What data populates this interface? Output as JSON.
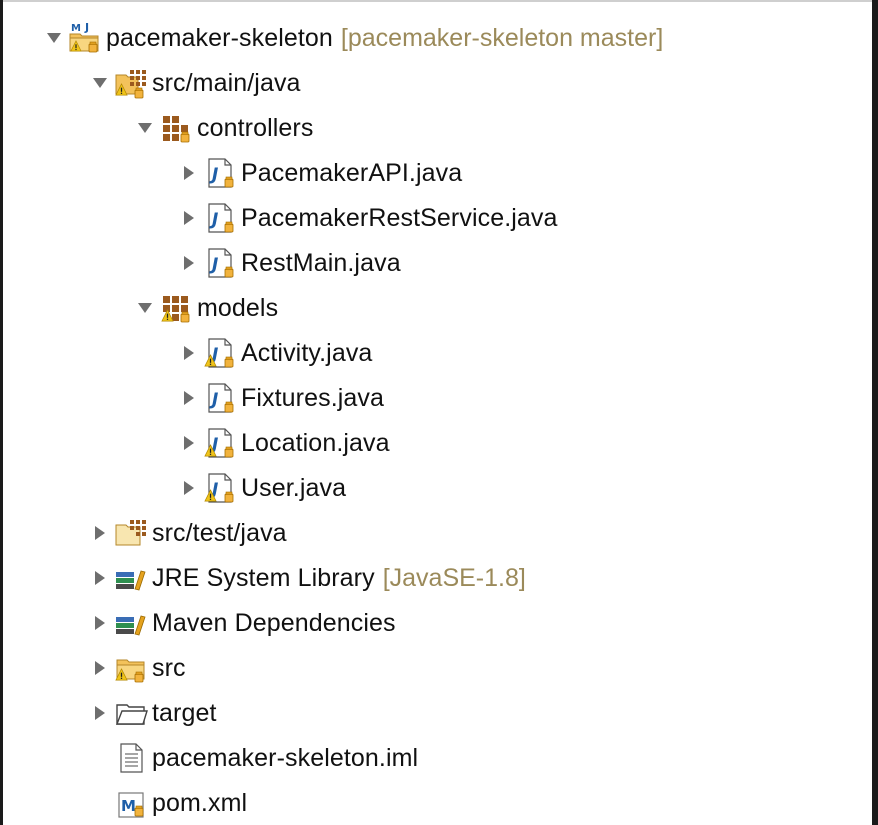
{
  "tree": {
    "project": {
      "label": "pacemaker-skeleton",
      "decoration": "[pacemaker-skeleton master]"
    },
    "src_main_java": {
      "label": "src/main/java"
    },
    "controllers": {
      "label": "controllers",
      "files": [
        "PacemakerAPI.java",
        "PacemakerRestService.java",
        "RestMain.java"
      ]
    },
    "models": {
      "label": "models",
      "files": [
        "Activity.java",
        "Fixtures.java",
        "Location.java",
        "User.java"
      ]
    },
    "src_test_java": {
      "label": "src/test/java"
    },
    "jre": {
      "label": "JRE System Library",
      "decoration": "[JavaSE-1.8]"
    },
    "maven": {
      "label": "Maven Dependencies"
    },
    "src": {
      "label": "src"
    },
    "target": {
      "label": "target"
    },
    "iml": {
      "label": "pacemaker-skeleton.iml"
    },
    "pom": {
      "label": "pom.xml"
    }
  },
  "icons": {
    "project": "maven-project-icon",
    "source_folder": "source-folder-icon",
    "package": "package-icon",
    "java_file": "java-file-icon",
    "library": "library-icon",
    "folder": "folder-icon",
    "text_file": "text-file-icon",
    "pom": "maven-pom-icon"
  },
  "colors": {
    "decoration": "#9b8a5a",
    "triangle": "#6e6e6e",
    "warning": "#f0c419",
    "folder": "#f3c25b",
    "java_blue": "#1f5fa8"
  }
}
